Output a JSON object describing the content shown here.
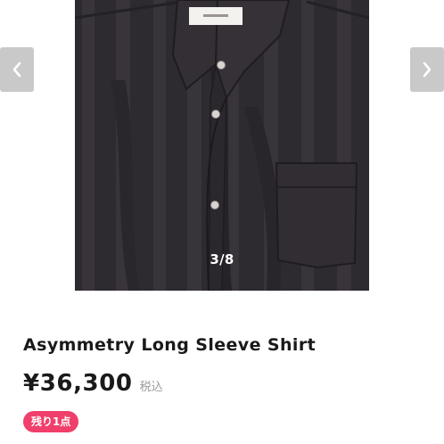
{
  "gallery": {
    "counter": "3/8",
    "prev_icon": "chevron-left-icon",
    "next_icon": "chevron-right-icon",
    "image": {
      "subject": "dark charcoal open-collar shirt with tonal vertical stripes",
      "shirt_color": "#2e2b30",
      "stripe_color": "#3a363c",
      "button_color": "#d9d4d2"
    }
  },
  "product": {
    "title": "Asymmetry Long Sleeve Shirt",
    "price": "¥36,300",
    "tax_label": "税込",
    "stock_badge": "残り1点"
  },
  "colors": {
    "badge": "#ef3f6a",
    "arrow_bg": "#c9c9c9",
    "text": "#1a1a1a",
    "muted": "#9a9a9a"
  }
}
